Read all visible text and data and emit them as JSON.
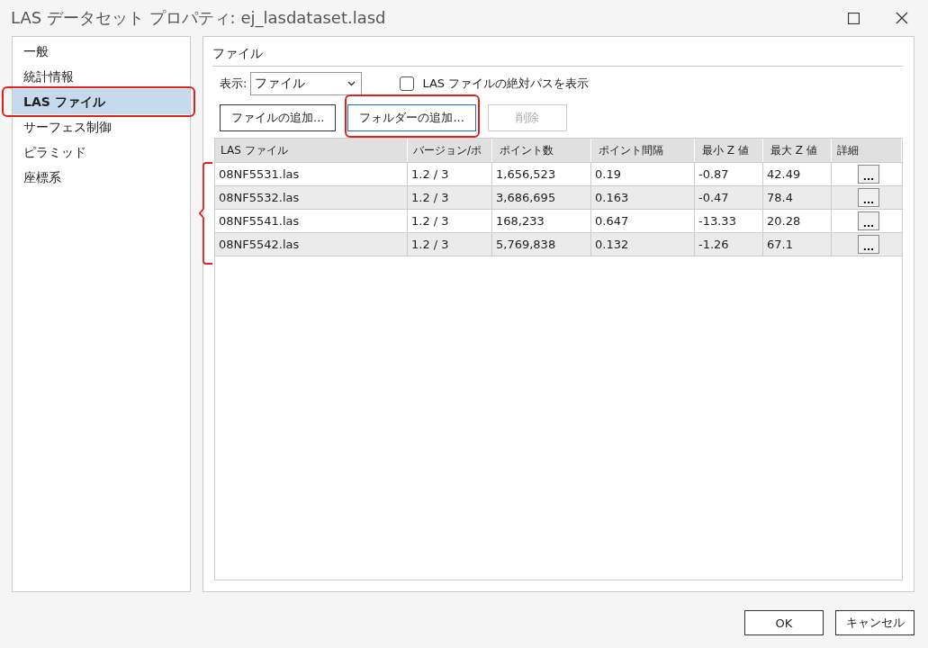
{
  "window": {
    "title": "LAS データセット プロパティ: ej_lasdataset.lasd"
  },
  "sidebar": {
    "items": [
      {
        "label": "一般",
        "selected": false,
        "highlighted": false
      },
      {
        "label": "統計情報",
        "selected": false,
        "highlighted": false
      },
      {
        "label": "LAS ファイル",
        "selected": true,
        "highlighted": true
      },
      {
        "label": "サーフェス制御",
        "selected": false,
        "highlighted": false
      },
      {
        "label": "ピラミッド",
        "selected": false,
        "highlighted": false
      },
      {
        "label": "座標系",
        "selected": false,
        "highlighted": false
      }
    ]
  },
  "section_title": "ファイル",
  "display": {
    "label": "表示:",
    "value": "ファイル"
  },
  "absolute_path": {
    "label": "LAS ファイルの絶対パスを表示",
    "checked": false
  },
  "actions": [
    {
      "label": "ファイルの追加...",
      "focused": false,
      "disabled": false,
      "highlighted": false
    },
    {
      "label": "フォルダーの追加...",
      "focused": true,
      "disabled": false,
      "highlighted": true
    },
    {
      "label": "削除",
      "focused": false,
      "disabled": true,
      "highlighted": false
    }
  ],
  "table": {
    "columns": [
      "LAS ファイル",
      "バージョン/ポ",
      "ポイント数",
      "ポイント間隔",
      "最小 Z 値",
      "最大 Z 値",
      "詳細"
    ],
    "rows_bracketed": true,
    "rows": [
      {
        "cells": [
          "08NF5531.las",
          "1.2 / 3",
          "1,656,523",
          "0.19",
          "-0.87",
          "42.49"
        ],
        "details": "..."
      },
      {
        "cells": [
          "08NF5532.las",
          "1.2 / 3",
          "3,686,695",
          "0.163",
          "-0.47",
          "78.4"
        ],
        "details": "..."
      },
      {
        "cells": [
          "08NF5541.las",
          "1.2 / 3",
          "168,233",
          "0.647",
          "-13.33",
          "20.28"
        ],
        "details": "..."
      },
      {
        "cells": [
          "08NF5542.las",
          "1.2 / 3",
          "5,769,838",
          "0.132",
          "-1.26",
          "67.1"
        ],
        "details": "..."
      }
    ]
  },
  "buttons": [
    "OK",
    "キャンセル"
  ]
}
